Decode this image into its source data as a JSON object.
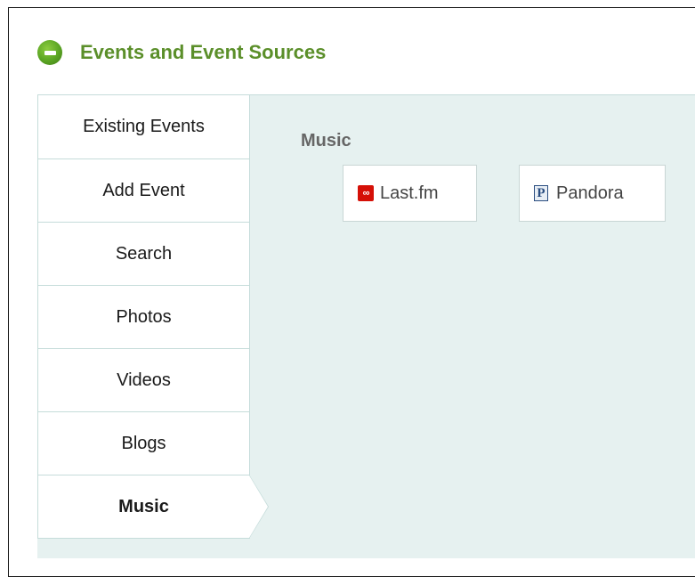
{
  "header": {
    "title": "Events and Event Sources"
  },
  "tabs": [
    {
      "label": "Existing Events"
    },
    {
      "label": "Add Event"
    },
    {
      "label": "Search"
    },
    {
      "label": "Photos"
    },
    {
      "label": "Videos"
    },
    {
      "label": "Blogs"
    },
    {
      "label": "Music",
      "active": true
    }
  ],
  "content": {
    "section_title": "Music",
    "sources": [
      {
        "name": "Last.fm",
        "icon": "lastfm-icon",
        "icon_glyph": "∞"
      },
      {
        "name": "Pandora",
        "icon": "pandora-icon",
        "icon_glyph": "P"
      }
    ]
  },
  "colors": {
    "title_green": "#5b8f2a",
    "panel_bg": "#e6f1f0",
    "lastfm_red": "#d51007"
  }
}
